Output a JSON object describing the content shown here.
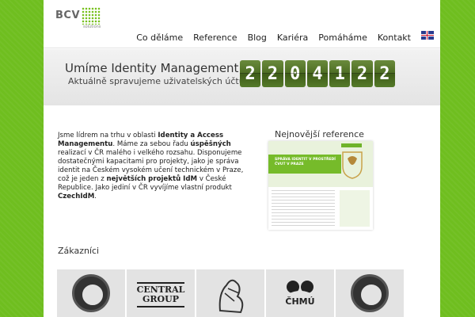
{
  "brand": {
    "name": "BCV",
    "tagline": "solutions",
    "accent": "#78c11f"
  },
  "nav": {
    "items": [
      "Co děláme",
      "Reference",
      "Blog",
      "Kariéra",
      "Pomáháme",
      "Kontakt"
    ],
    "language_icon": "uk-flag-icon"
  },
  "banner": {
    "title": "Umíme Identity Management",
    "subtitle": "Aktuálně spravujeme uživatelských účtů:",
    "counter_digits": [
      "2",
      "2",
      "0",
      "4",
      "1",
      "2",
      "2"
    ]
  },
  "intro": {
    "t1": "Jsme lídrem na trhu v oblasti ",
    "b1": "Identity a Access Managementu",
    "t2": ". Máme za sebou řadu ",
    "b2": "úspěšných",
    "t3": " realizací v ČR malého i velkého rozsahu. Disponujeme dostatečnými kapacitami pro projekty, jako je správa identit na Českém vysokém učení technickém v Praze, což je jeden z ",
    "b3": "největších projektů IdM",
    "t4": " v České Republice. Jako jediní v ČR vyvíjíme vlastní produkt ",
    "b4": "CzechIdM",
    "t5": "."
  },
  "references": {
    "title": "Nejnovější reference",
    "card_headline": "SPRÁVA IDENTIT V PROSTŘEDÍ ČVUT V PRAZE"
  },
  "clients": {
    "title": "Zákazníci",
    "logos": [
      {
        "name": "seal-logo",
        "text": ""
      },
      {
        "name": "central-group-logo",
        "text": "CENTRAL GROUP"
      },
      {
        "name": "czech-lion-logo",
        "text": ""
      },
      {
        "name": "chmu-logo",
        "text": "ČHMÚ"
      },
      {
        "name": "cvut-seal-logo",
        "text": ""
      }
    ]
  }
}
